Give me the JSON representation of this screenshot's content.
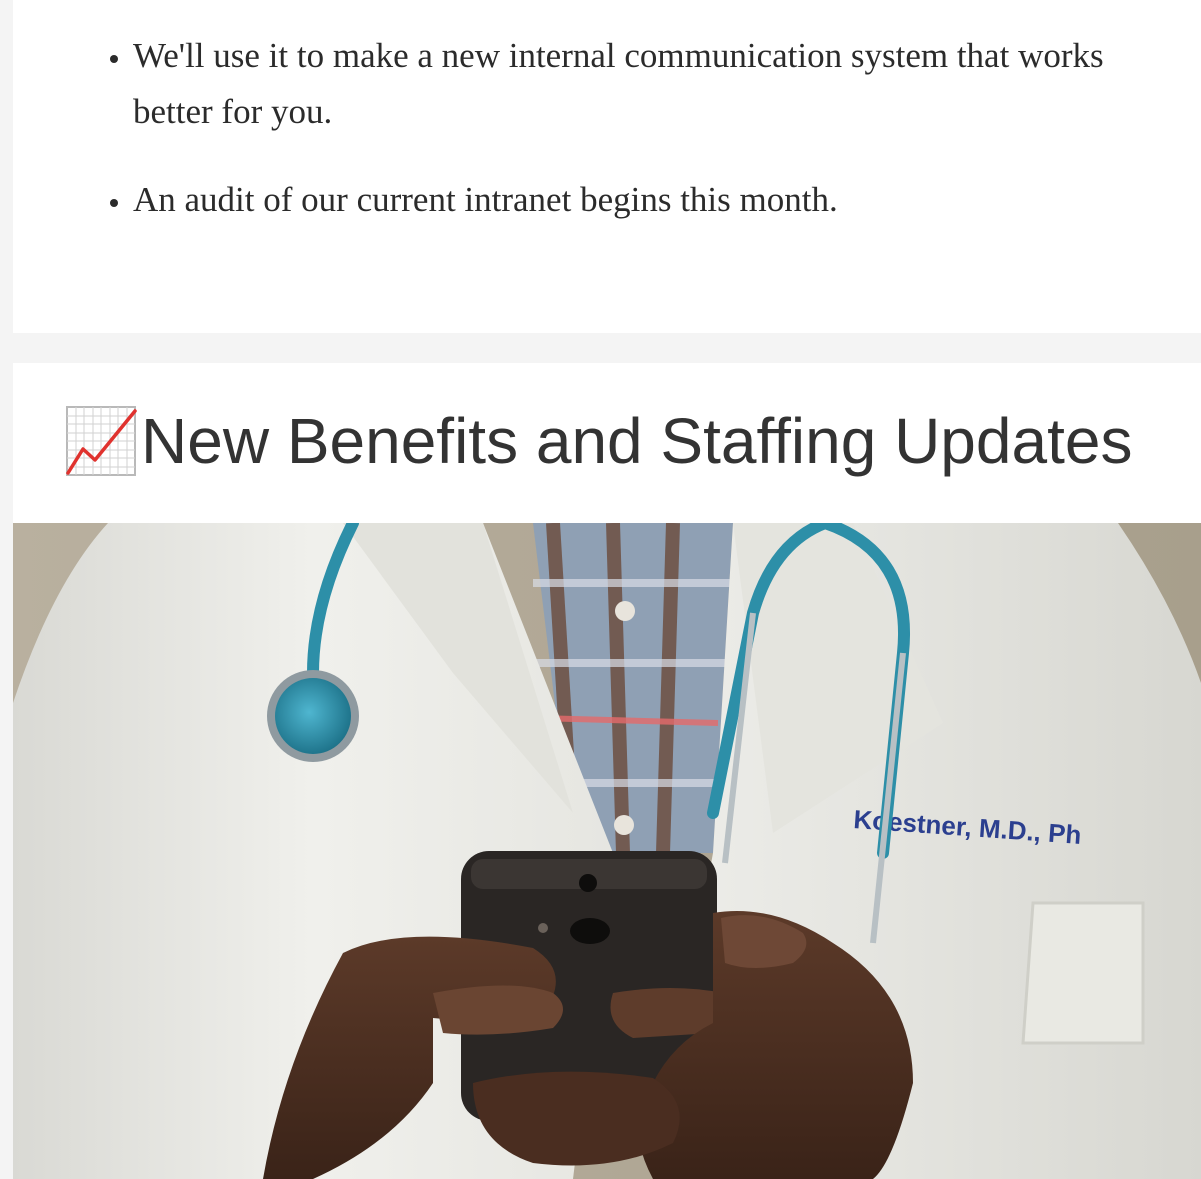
{
  "intro_section": {
    "bullets": [
      "We'll use it to make a new internal communication system that works better for you.",
      "An audit of our current intranet begins this month."
    ]
  },
  "benefits_section": {
    "heading_icon": "chart-increasing-icon",
    "heading": "New Benefits and Staffing Updates",
    "photo_badge_text": "Koestner, M.D., Ph",
    "colors": {
      "heading_text": "#333333",
      "body_text": "#2b2b2b",
      "page_background": "#f4f4f4",
      "card_background": "#ffffff",
      "chart_line": "#e0322e",
      "stethoscope": "#2d8fa8"
    }
  }
}
